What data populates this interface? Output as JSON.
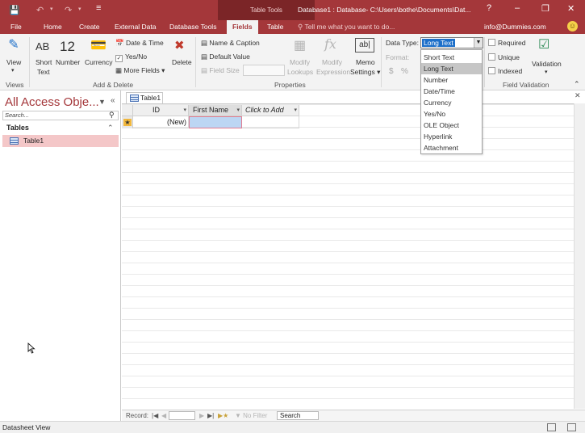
{
  "title_bar": {
    "context_tab_group": "Table Tools",
    "window_title": "Database1 : Database- C:\\Users\\bothe\\Documents\\Dat...",
    "help_label": "?"
  },
  "tabs": {
    "file": "File",
    "home": "Home",
    "create": "Create",
    "external_data": "External Data",
    "database_tools": "Database Tools",
    "fields": "Fields",
    "table": "Table",
    "tell_me": "Tell me what you want to do...",
    "account": "info@Dummies.com",
    "active": "Fields"
  },
  "ribbon": {
    "views": {
      "view_label": "View",
      "group_label": "Views"
    },
    "add_delete": {
      "short_text_glyph": "AB",
      "short_text_label_1": "Short",
      "short_text_label_2": "Text",
      "number_glyph": "12",
      "number_label": "Number",
      "currency_label": "Currency",
      "date_time": "Date & Time",
      "yes_no": "Yes/No",
      "more_fields": "More Fields",
      "delete": "Delete",
      "group_label": "Add & Delete"
    },
    "properties": {
      "name_caption": "Name & Caption",
      "default_value": "Default Value",
      "field_size": "Field Size",
      "modify_lookups_1": "Modify",
      "modify_lookups_2": "Lookups",
      "modify_expression_1": "Modify",
      "modify_expression_2": "Expression",
      "memo_settings_1": "Memo",
      "memo_settings_2": "Settings",
      "group_label": "Properties"
    },
    "formatting": {
      "data_type_label": "Data Type:",
      "data_type_value": "Long Text",
      "format_label": "Format:",
      "currency_symbol": "$",
      "percent_symbol": "%"
    },
    "validation": {
      "required": "Required",
      "unique": "Unique",
      "indexed": "Indexed",
      "validation_label": "Validation",
      "group_label": "Field Validation"
    }
  },
  "data_type_options": [
    "Short Text",
    "Long Text",
    "Number",
    "Date/Time",
    "Currency",
    "Yes/No",
    "OLE Object",
    "Hyperlink",
    "Attachment"
  ],
  "highlighted_option": "Long Text",
  "nav_pane": {
    "title": "All Access Obje...",
    "search_placeholder": "Search...",
    "group": "Tables",
    "items": [
      "Table1"
    ]
  },
  "document": {
    "tab_label": "Table1",
    "columns": [
      "ID",
      "First Name",
      "Click to Add"
    ],
    "new_row_id": "(New)"
  },
  "record_nav": {
    "record_label": "Record:",
    "no_filter": "No Filter",
    "search": "Search"
  },
  "status_bar": {
    "view": "Datasheet View"
  },
  "colors": {
    "accent": "#a4373a",
    "selection": "#1d6fc9",
    "nav_highlight": "#f4c7c8"
  }
}
